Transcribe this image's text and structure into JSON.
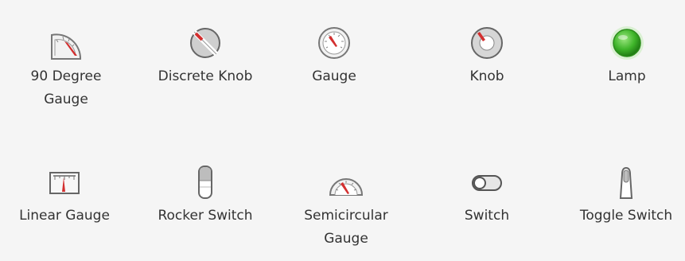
{
  "palette": {
    "items": [
      {
        "label": "90 Degree Gauge",
        "icon": "quarter-gauge-icon"
      },
      {
        "label": "Discrete Knob",
        "icon": "discrete-knob-icon"
      },
      {
        "label": "Gauge",
        "icon": "gauge-icon"
      },
      {
        "label": "Knob",
        "icon": "knob-icon"
      },
      {
        "label": "Lamp",
        "icon": "lamp-icon"
      },
      {
        "label": "Linear Gauge",
        "icon": "linear-gauge-icon"
      },
      {
        "label": "Rocker Switch",
        "icon": "rocker-switch-icon"
      },
      {
        "label": "Semicircular Gauge",
        "icon": "semicircular-gauge-icon"
      },
      {
        "label": "Switch",
        "icon": "switch-icon"
      },
      {
        "label": "Toggle Switch",
        "icon": "toggle-switch-icon"
      }
    ],
    "colors": {
      "needle": "#d32f2f",
      "lamp": "#3fb52a",
      "outline": "#777777"
    }
  }
}
